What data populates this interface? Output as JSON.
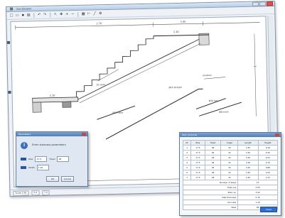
{
  "window": {
    "title": "Stair Designer",
    "status_fields": [
      "Scale 1:50",
      "X 0",
      "Y 0"
    ]
  },
  "toolbar": {
    "icons": [
      "new-icon",
      "open-icon",
      "save-icon",
      "print-icon",
      "undo-icon",
      "redo-icon",
      "select-icon",
      "pan-icon",
      "zoom-in-icon",
      "zoom-out-icon",
      "grid-icon",
      "measure-icon",
      "line-icon",
      "settings-icon"
    ]
  },
  "drawing": {
    "dim_top_left": "2.70",
    "dim_top_right": "3.45",
    "dim_landing": "1.10",
    "dim_bottom": "2.10",
    "annot_1": "10 stairs",
    "annot_2": "handrail",
    "annot_3": "Ø16 stringer",
    "annot_4": "Ø12 rebar",
    "annot_5": "Ø10 ties",
    "annot_6": "Ø8 mesh"
  },
  "dialog": {
    "title": "Parameters",
    "info_glyph": "i",
    "message": "Enter staircase parameters",
    "row1_label": "Rise",
    "row1_value": "17.5",
    "row1_label2": "Tread",
    "row1_value2": "28",
    "row2_label": "Width",
    "row2_value": "1.20",
    "ok_label": "OK",
    "cancel_label": "Cancel"
  },
  "table": {
    "title": "Stair schedule",
    "headers": [
      "Nr",
      "Rise",
      "Tread",
      "Angle",
      "Length",
      "Height"
    ],
    "rows": [
      [
        "1",
        "17.5",
        "28",
        "32",
        "3.30",
        "0.18"
      ],
      [
        "2",
        "17.5",
        "28",
        "32",
        "3.30",
        "0.35"
      ],
      [
        "3",
        "17.5",
        "28",
        "32",
        "3.30",
        "0.53"
      ],
      [
        "4",
        "17.5",
        "28",
        "32",
        "3.30",
        "0.70"
      ],
      [
        "5",
        "17.5",
        "28",
        "32",
        "3.30",
        "0.88"
      ],
      [
        "6",
        "17.5",
        "28",
        "32",
        "3.30",
        "1.05"
      ],
      [
        "7",
        "17.5",
        "28",
        "32",
        "3.30",
        "1.23"
      ]
    ],
    "summary": [
      [
        "Number of steps",
        "15"
      ],
      [
        "Total rise",
        "2.63"
      ],
      [
        "Total run",
        "3.92"
      ],
      [
        "Slab thickness",
        "0.15"
      ],
      [
        "Concrete",
        "1.24"
      ],
      [
        "Steel",
        "86"
      ]
    ],
    "ok_label": "Close"
  }
}
